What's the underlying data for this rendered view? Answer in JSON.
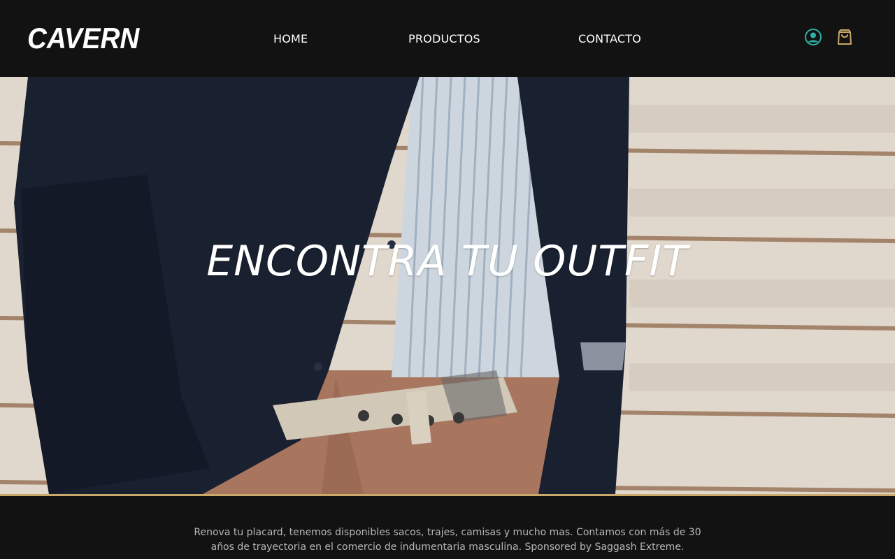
{
  "brand": {
    "logo_text": "CAVERN"
  },
  "nav": {
    "items": [
      {
        "label": "HOME"
      },
      {
        "label": "PRODUCTOS"
      },
      {
        "label": "CONTACTO"
      }
    ]
  },
  "header_icons": {
    "user": {
      "icon": "user-circle-icon",
      "color": "#2bb3a3"
    },
    "cart": {
      "icon": "shopping-bag-icon",
      "color": "#c9a86a"
    }
  },
  "hero": {
    "title": "ENCONTRA TU OUTFIT"
  },
  "about": {
    "text": "Renova tu placard, tenemos disponibles sacos, trajes, camisas y mucho mas. Contamos con más de 30 años de trayectoria en el comercio de indumentaria masculina. Sponsored by Saggash Extreme."
  },
  "colors": {
    "header_bg": "#121212",
    "accent_gold": "#c9a86a",
    "accent_teal": "#2bb3a3",
    "text_muted": "#b7b7b7"
  }
}
